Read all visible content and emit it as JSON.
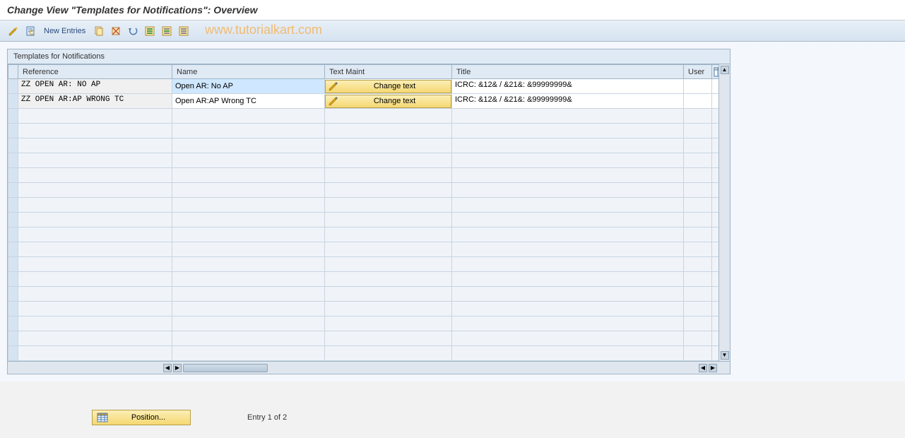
{
  "page_title": "Change View \"Templates for Notifications\": Overview",
  "toolbar": {
    "new_entries_label": "New Entries"
  },
  "watermark": "www.tutorialkart.com",
  "table": {
    "title": "Templates for Notifications",
    "columns": {
      "reference": "Reference",
      "name": "Name",
      "text_maint": "Text Maint",
      "title": "Title",
      "user": "User"
    },
    "change_text_label": "Change text",
    "rows": [
      {
        "reference": "ZZ OPEN AR: NO AP",
        "name": "Open AR: No AP",
        "title": "ICRC: &12& / &21&: &99999999&",
        "user": "",
        "name_selected": true
      },
      {
        "reference": "ZZ OPEN AR:AP WRONG TC",
        "name": "Open AR:AP Wrong TC",
        "title": "ICRC: &12& / &21&: &99999999&",
        "user": "",
        "name_selected": false
      }
    ],
    "empty_rows": 17
  },
  "footer": {
    "position_label": "Position...",
    "entry_status": "Entry 1 of 2"
  }
}
